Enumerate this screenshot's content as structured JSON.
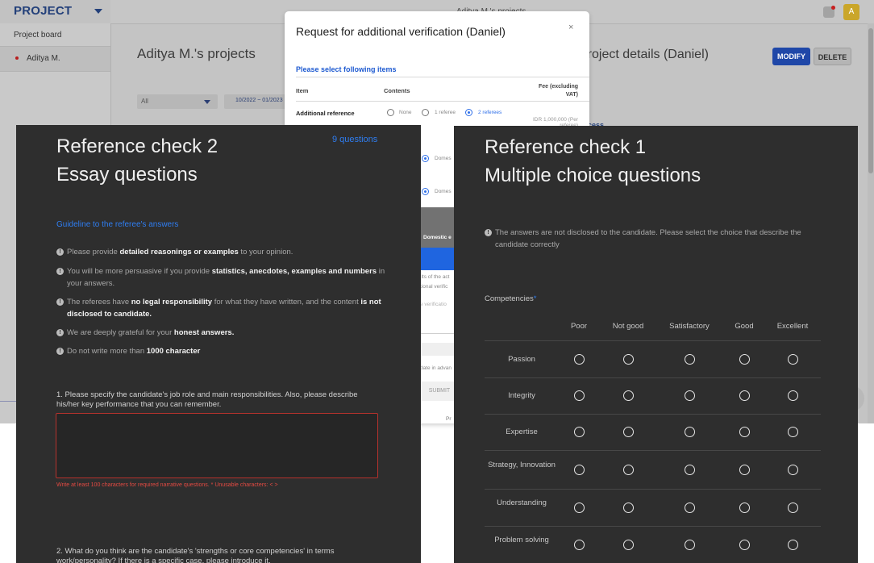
{
  "app": {
    "brand": "PROJECT",
    "topbar_title": "Aditya M.'s projects",
    "avatar_letter": "A",
    "sidebar": {
      "project_board": "Project board",
      "items": [
        {
          "label": "Aditya M."
        }
      ]
    },
    "main_title": "Aditya M.'s projects",
    "filter_all": "All",
    "filter_date": "10/2022 ~ 01/2023",
    "detail_title": "Project details (Daniel)",
    "modify": "MODIFY",
    "delete": "DELETE",
    "detail_link": "cess"
  },
  "modal": {
    "title": "Request for additional verification (Daniel)",
    "close": "×",
    "subtitle": "Please select following items",
    "th_item": "Item",
    "th_contents": "Contents",
    "th_fee": "Fee (excluding VAT)",
    "row_label": "Additional reference",
    "opt_none": "None",
    "opt_1": "1 referee",
    "opt_2": "2 referees",
    "fee_value": "IDR 1,000,000 (Per referee)",
    "domestic_a": "Domes",
    "domestic_b": "Domes",
    "band_label": "Domestic e",
    "txt_1": "ilts of the act",
    "txt_2": "tional verific",
    "txt_3": "e verificatio",
    "txt_4": "date in advan",
    "submit": "SUBMIT",
    "pr": "Pr"
  },
  "ref2": {
    "title_line1": "Reference check 2",
    "title_line2": "Essay questions",
    "count": "9 questions",
    "guideline": "Guideline to the referee's answers",
    "bullets": {
      "b1_pre": "Please provide ",
      "b1_bold": "detailed reasonings or examples",
      "b1_post": " to your opinion.",
      "b2_pre": "You will be more persuasive if you provide ",
      "b2_bold": "statistics, anecdotes, examples and numbers",
      "b2_post": " in your answers.",
      "b3_pre": "The referees have ",
      "b3_bold1": "no legal responsibility",
      "b3_mid": " for what they have written, and the content ",
      "b3_bold2": "is not disclosed to candidate.",
      "b4_pre": "We are deeply grateful for your ",
      "b4_bold": "honest answers.",
      "b5_pre": "Do not write more than ",
      "b5_bold": "1000 character"
    },
    "q1": "1. Please specify the candidate's job role and main responsibilities. Also, please describe his/her key performance that you can remember.",
    "q1_error": "Write at least 100 characters for required narrative questions. * Unusable characters: < >",
    "q2": "2. What do you think are the candidate's 'strengths or core competencies' in terms work/personality? If there is a specific case, please introduce it."
  },
  "ref1": {
    "title_line1": "Reference check 1",
    "title_line2": "Multiple choice questions",
    "note": "The answers are not disclosed to the candidate. Please select the choice that describe the candidate correctly",
    "section": "Competencies",
    "required_mark": "*",
    "columns": [
      "Poor",
      "Not good",
      "Satisfactory",
      "Good",
      "Excellent"
    ],
    "rows": [
      "Passion",
      "Integrity",
      "Expertise",
      "Strategy, Innovation",
      "Understanding",
      "Problem solving"
    ]
  },
  "colors": {
    "panel_bg": "#2e2e2e",
    "accent_blue": "#2f7ef2",
    "error_red": "#e34a42",
    "modify_blue": "#1f47a8"
  }
}
